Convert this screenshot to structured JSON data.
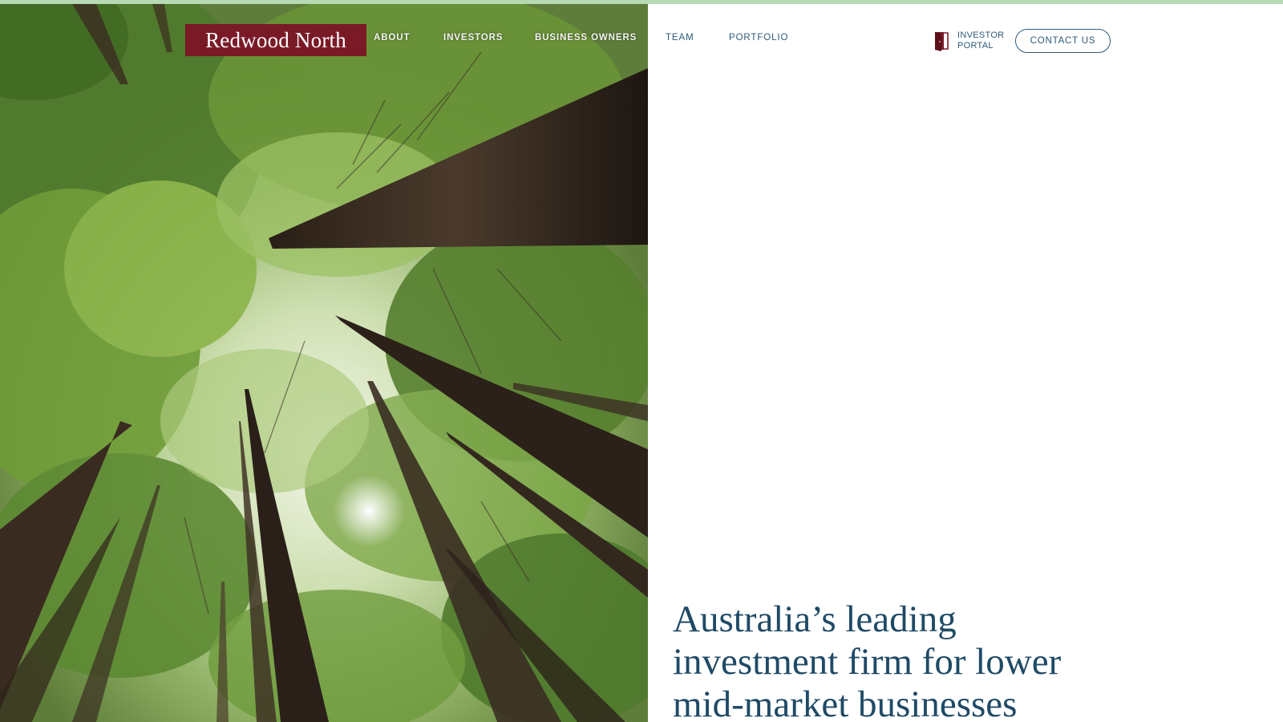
{
  "colors": {
    "brand": "#7a1a26",
    "nav_text": "#2d5a7a",
    "headline": "#1f4a66",
    "top_strip": "#b7d9b4"
  },
  "header": {
    "logo_text": "Redwood North",
    "nav": [
      {
        "label": "ABOUT"
      },
      {
        "label": "INVESTORS"
      },
      {
        "label": "BUSINESS OWNERS"
      },
      {
        "label": "TEAM"
      },
      {
        "label": "PORTFOLIO"
      }
    ],
    "portal": {
      "icon": "door-icon",
      "line1": "INVESTOR",
      "line2": "PORTAL"
    },
    "contact_label": "CONTACT US"
  },
  "hero": {
    "image": "redwood-forest-canopy-photo",
    "headline_lines": [
      "Australia’s leading",
      "investment firm for lower",
      "mid-market businesses"
    ]
  }
}
